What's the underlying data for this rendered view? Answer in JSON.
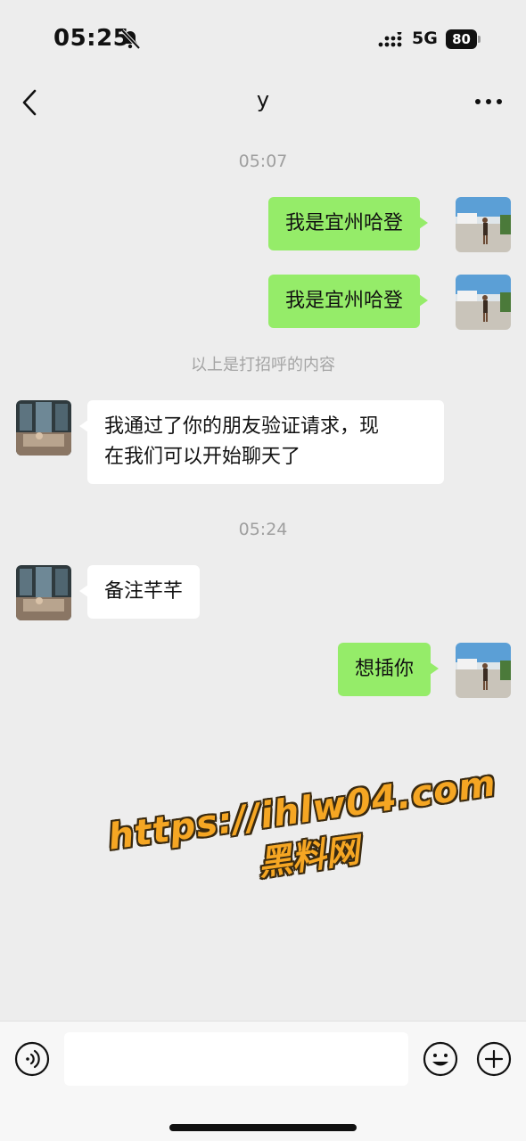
{
  "status_bar": {
    "time": "05:25",
    "network": "5G",
    "battery": "80",
    "icons": [
      "bell-slash-icon",
      "signal-icon"
    ]
  },
  "nav": {
    "title": "y",
    "back_icon": "chevron-left-icon",
    "more_icon": "more-horizontal-icon"
  },
  "messages": {
    "timestamp_1": "05:07",
    "me_1": "我是宜州哈登",
    "me_2": "我是宜州哈登",
    "system_note": "以上是打招呼的内容",
    "other_1_line1": "我通过了你的朋友验证请求，现",
    "other_1_line2": "在我们可以开始聊天了",
    "timestamp_2": "05:24",
    "other_2": "备注芊芊",
    "me_3": "想插你"
  },
  "watermark": {
    "url": "https://ihlw04.com",
    "name": "黑料网"
  },
  "input_bar": {
    "placeholder": "",
    "icons": [
      "voice-icon",
      "emoji-icon",
      "plus-icon"
    ]
  },
  "colors": {
    "background": "#ededed",
    "my_bubble": "#95ec69",
    "other_bubble": "#ffffff",
    "watermark": "#f5a623"
  }
}
